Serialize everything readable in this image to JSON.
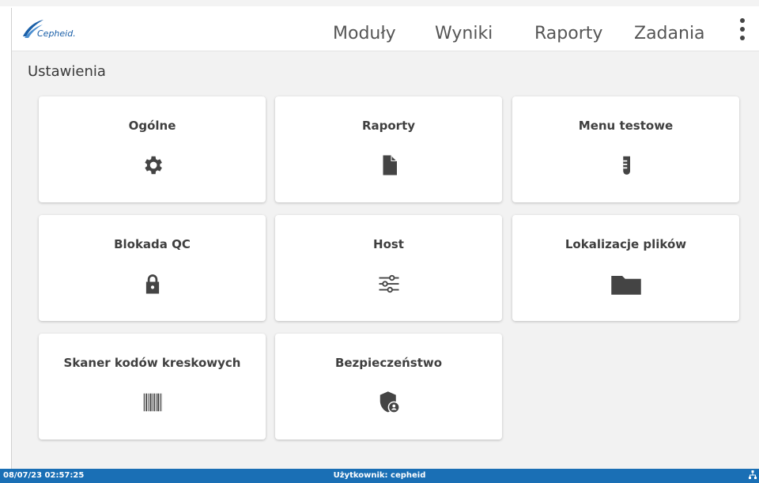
{
  "header": {
    "logo_text": "Cepheid.",
    "nav": [
      {
        "label": "Moduły"
      },
      {
        "label": "Wyniki"
      },
      {
        "label": "Raporty"
      },
      {
        "label": "Zadania"
      }
    ]
  },
  "page": {
    "title": "Ustawienia"
  },
  "tiles": [
    {
      "label": "Ogólne",
      "icon": "gear-icon"
    },
    {
      "label": "Raporty",
      "icon": "document-icon"
    },
    {
      "label": "Menu testowe",
      "icon": "test-tube-icon"
    },
    {
      "label": "Blokada QC",
      "icon": "lock-icon"
    },
    {
      "label": "Host",
      "icon": "sliders-icon"
    },
    {
      "label": "Lokalizacje plików",
      "icon": "folder-icon"
    },
    {
      "label": "Skaner kodów kreskowych",
      "icon": "barcode-icon"
    },
    {
      "label": "Bezpieczeństwo",
      "icon": "shield-user-icon"
    }
  ],
  "status_bar": {
    "timestamp": "08/07/23 02:57:25",
    "user": "Użytkownik: cepheid",
    "network_icon": "network-icon"
  },
  "colors": {
    "brand_blue": "#1a6fb5",
    "icon_gray": "#444444",
    "background": "#f2f2f2"
  }
}
